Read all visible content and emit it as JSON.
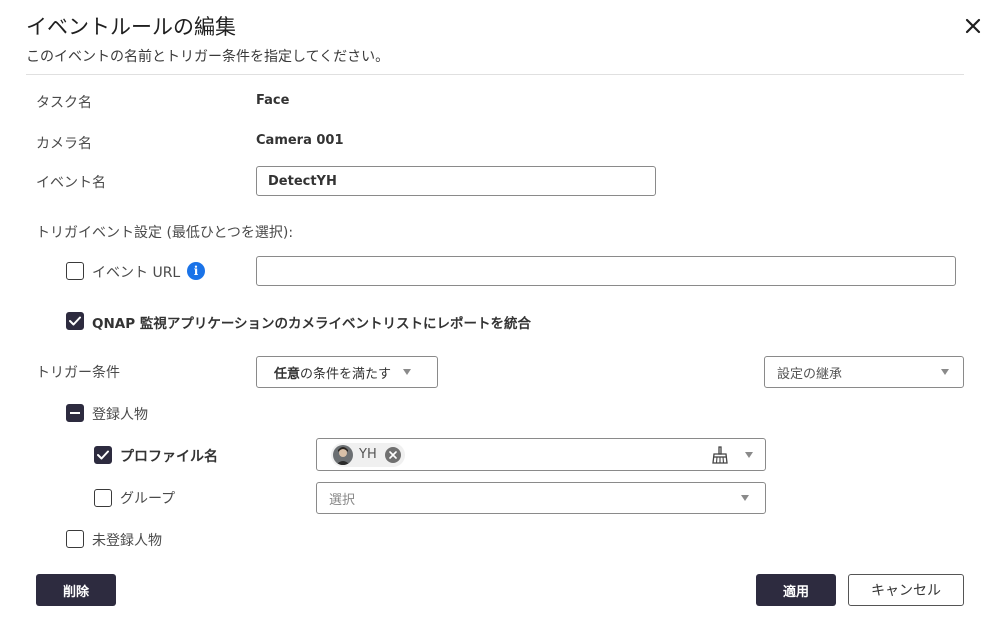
{
  "dialog": {
    "title": "イベントルールの編集",
    "subtitle": "このイベントの名前とトリガー条件を指定してください。"
  },
  "fields": {
    "task_label": "タスク名",
    "task_value": "Face",
    "camera_label": "カメラ名",
    "camera_value": "Camera 001",
    "event_label": "イベント名",
    "event_value": "DetectYH"
  },
  "trigger_settings": {
    "heading": "トリガイベント設定 (最低ひとつを選択):",
    "event_url_label": "イベント URL",
    "event_url_checked": false,
    "event_url_value": "",
    "integrate_label": "QNAP 監視アプリケーションのカメライベントリストにレポートを統合",
    "integrate_checked": true
  },
  "trigger_condition": {
    "label": "トリガー条件",
    "match_bold": "任意",
    "match_rest": "の条件を満たす",
    "inherit_placeholder": "設定の継承"
  },
  "registered": {
    "label": "登録人物",
    "state": "partial",
    "profile_label": "プロファイル名",
    "profile_checked": true,
    "profile_chips": [
      "YH"
    ],
    "group_label": "グループ",
    "group_checked": false,
    "group_placeholder": "選択"
  },
  "unregistered": {
    "label": "未登録人物",
    "checked": false
  },
  "buttons": {
    "delete": "削除",
    "apply": "適用",
    "cancel": "キャンセル"
  },
  "icons": {
    "close": "close-icon",
    "info": "info-icon",
    "clear": "broom-icon",
    "chip_remove": "x-circle-icon"
  },
  "colors": {
    "primary": "#2d2b3f",
    "info": "#1a73e8"
  }
}
